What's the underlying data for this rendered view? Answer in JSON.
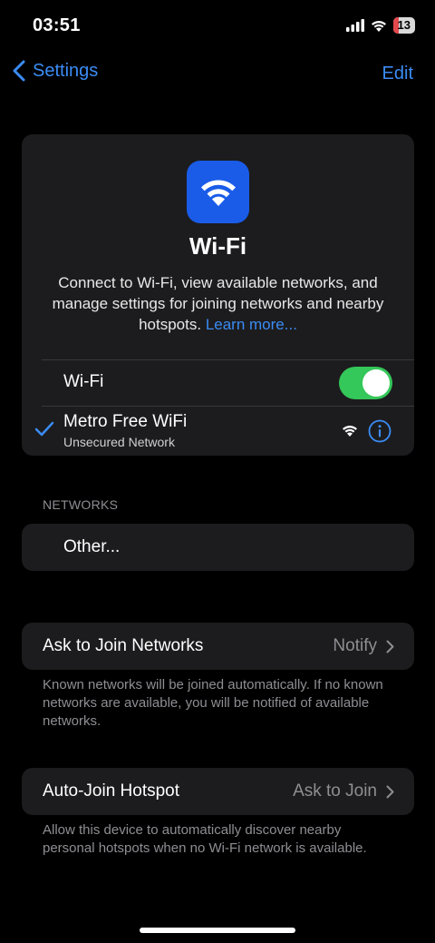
{
  "status_bar": {
    "time": "03:51",
    "battery": "13",
    "icons": [
      "cellular-signal-icon",
      "wifi-icon",
      "battery-icon"
    ]
  },
  "nav": {
    "back_label": "Settings",
    "edit_label": "Edit"
  },
  "hero": {
    "icon": "wifi-icon",
    "title": "Wi-Fi",
    "description": "Connect to Wi-Fi, view available networks, and manage settings for joining networks and nearby hotspots.",
    "learn_more": "Learn more..."
  },
  "wifi_toggle": {
    "label": "Wi-Fi",
    "enabled": true
  },
  "connected_network": {
    "name": "Metro Free WiFi",
    "subtitle": "Unsecured Network"
  },
  "networks": {
    "header": "NETWORKS",
    "other_label": "Other..."
  },
  "ask_to_join": {
    "label": "Ask to Join Networks",
    "value": "Notify",
    "footnote": "Known networks will be joined automatically. If no known networks are available, you will be notified of available networks."
  },
  "auto_join_hotspot": {
    "label": "Auto-Join Hotspot",
    "value": "Ask to Join",
    "footnote": "Allow this device to automatically discover nearby personal hotspots when no Wi-Fi network is available."
  },
  "colors": {
    "accent": "#3b8cf5",
    "toggle_on": "#34c759",
    "app_icon": "#1a5ce8",
    "card": "#1c1c1e"
  }
}
